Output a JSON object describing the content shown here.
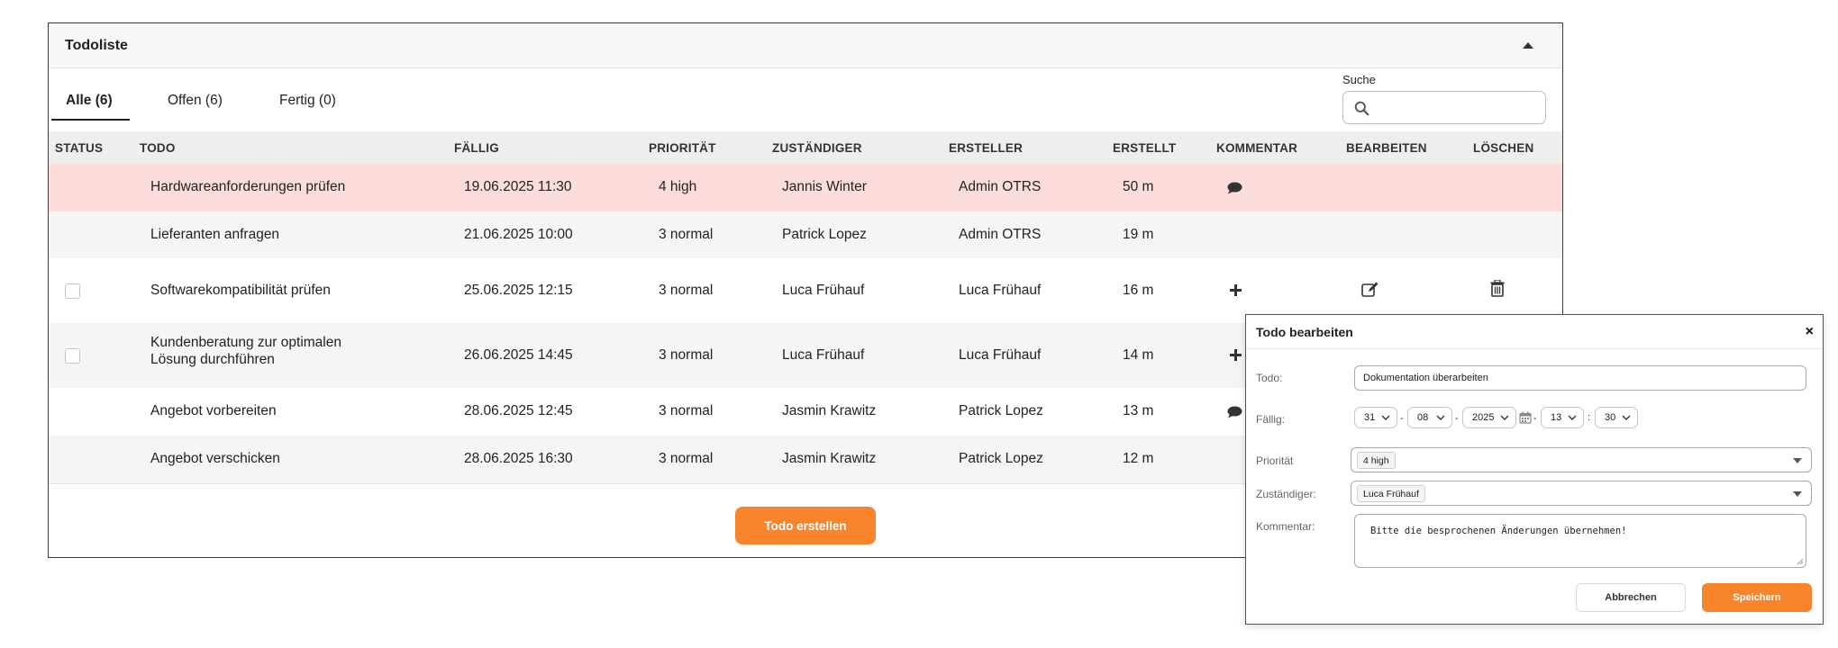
{
  "panel": {
    "title": "Todoliste",
    "tabs": [
      {
        "label": "Alle (6)",
        "active": true
      },
      {
        "label": "Offen (6)",
        "active": false
      },
      {
        "label": "Fertig (0)",
        "active": false
      }
    ],
    "search": {
      "label": "Suche",
      "placeholder": ""
    },
    "columns": [
      "STATUS",
      "TODO",
      "FÄLLIG",
      "PRIORITÄT",
      "ZUSTÄNDIGER",
      "ERSTELLER",
      "ERSTELLT",
      "KOMMENTAR",
      "BEARBEITEN",
      "LÖSCHEN"
    ],
    "rows": [
      {
        "todo": "Hardwareanforderungen prüfen",
        "todo2": "",
        "due": "19.06.2025 11:30",
        "priority": "4 high",
        "assignee": "Jannis Winter",
        "creator": "Admin OTRS",
        "created": "50 m",
        "checkbox": false,
        "comment_icon": "comment-icon",
        "edit": false,
        "delete": false,
        "bg": "#fddcdc"
      },
      {
        "todo": "Lieferanten anfragen",
        "todo2": "",
        "due": "21.06.2025 10:00",
        "priority": "3 normal",
        "assignee": "Patrick Lopez",
        "creator": "Admin OTRS",
        "created": "19 m",
        "checkbox": false,
        "comment_icon": "",
        "edit": false,
        "delete": false,
        "bg": "#f5f5f5"
      },
      {
        "todo": "Softwarekompatibilität prüfen",
        "todo2": "",
        "due": "25.06.2025 12:15",
        "priority": "3 normal",
        "assignee": "Luca Frühauf",
        "creator": "Luca Frühauf",
        "created": "16 m",
        "checkbox": true,
        "comment_icon": "plus-icon",
        "edit": true,
        "delete": true,
        "bg": "#ffffff"
      },
      {
        "todo": "Kundenberatung zur optimalen",
        "todo2": "Lösung durchführen",
        "due": "26.06.2025 14:45",
        "priority": "3 normal",
        "assignee": "Luca Frühauf",
        "creator": "Luca Frühauf",
        "created": "14 m",
        "checkbox": true,
        "comment_icon": "plus-icon",
        "edit": false,
        "delete": false,
        "bg": "#f5f5f5"
      },
      {
        "todo": "Angebot vorbereiten",
        "todo2": "",
        "due": "28.06.2025 12:45",
        "priority": "3 normal",
        "assignee": "Jasmin Krawitz",
        "creator": "Patrick Lopez",
        "created": "13 m",
        "checkbox": false,
        "comment_icon": "comment-icon",
        "edit": false,
        "delete": false,
        "bg": "#ffffff"
      },
      {
        "todo": "Angebot verschicken",
        "todo2": "",
        "due": "28.06.2025 16:30",
        "priority": "3 normal",
        "assignee": "Jasmin Krawitz",
        "creator": "Patrick Lopez",
        "created": "12 m",
        "checkbox": false,
        "comment_icon": "",
        "edit": false,
        "delete": false,
        "bg": "#f5f5f5"
      }
    ],
    "create_button": "Todo erstellen"
  },
  "modal": {
    "title": "Todo bearbeiten",
    "close": "×",
    "todo_label": "Todo:",
    "todo_value": "Dokumentation überarbeiten",
    "due_label": "Fällig:",
    "due": {
      "day": "31",
      "month": "08",
      "year": "2025",
      "hour": "13",
      "minute": "30"
    },
    "due_separators": {
      "date": "-",
      "time_dash": "-",
      "time_colon": ":"
    },
    "priority_label": "Priorität",
    "priority_value": "4 high",
    "assignee_label": "Zuständiger:",
    "assignee_value": "Luca Frühauf",
    "comment_label": "Kommentar:",
    "comment_value": "Bitte die besprochenen Änderungen übernehmen!",
    "cancel_button": "Abbrechen",
    "save_button": "Speichern"
  },
  "colors": {
    "accent": "#f8842c",
    "overdue_row": "#fddcdc"
  }
}
